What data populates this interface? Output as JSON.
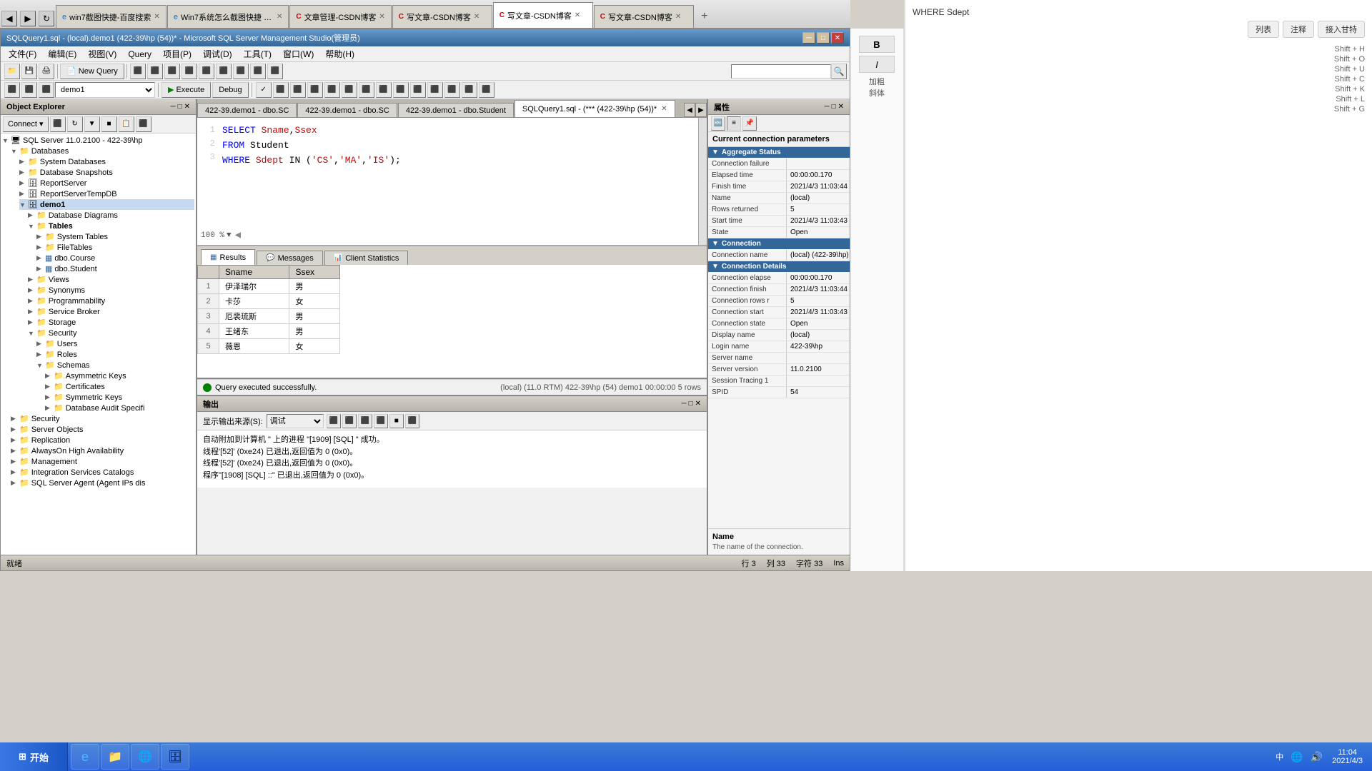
{
  "window": {
    "title": "SQLQuery1.sql - (local).demo1 (422-39\\hp (54))* - Microsoft SQL Server Management Studio(管理员)",
    "tabs": [
      {
        "label": "win7截图快捷-百度搜索",
        "active": false,
        "icon": "ie"
      },
      {
        "label": "Win7系统怎么截图快捷 5种:...",
        "active": false,
        "icon": "ie"
      },
      {
        "label": "文章管理-CSDN博客",
        "active": false,
        "icon": "csdn"
      },
      {
        "label": "写文章-CSDN博客",
        "active": false,
        "icon": "csdn"
      },
      {
        "label": "写文章-CSDN博客",
        "active": true,
        "icon": "csdn"
      },
      {
        "label": "写文章-CSDN博客",
        "active": false,
        "icon": "csdn"
      }
    ]
  },
  "ssms": {
    "title": "SQLQuery1.sql - (local).demo1 (422-39\\hp (54))* - Microsoft SQL Server Management Studio(管理员)",
    "menubar": [
      "文件(F)",
      "编辑(E)",
      "视图(V)",
      "Query",
      "项目(P)",
      "调试(D)",
      "工具(T)",
      "窗口(W)",
      "帮助(H)"
    ],
    "toolbar": {
      "db_selector": "demo1",
      "execute_btn": "Execute",
      "debug_btn": "Debug"
    },
    "doc_tabs": [
      {
        "label": "422-39.demo1 - dbo.SC",
        "active": false
      },
      {
        "label": "422-39.demo1 - dbo.SC",
        "active": false
      },
      {
        "label": "422-39.demo1 - dbo.Student",
        "active": false
      },
      {
        "label": "SQLQuery1.sql - (*** (422-39\\hp (54))*",
        "active": true
      }
    ],
    "sql_code": [
      "SELECT Sname,Ssex",
      "FROM Student",
      "WHERE Sdept IN ('CS','MA','IS');"
    ],
    "zoom": "100 %",
    "result_tabs": [
      {
        "label": "Results",
        "active": true,
        "icon": "grid"
      },
      {
        "label": "Messages",
        "active": false,
        "icon": "msg"
      },
      {
        "label": "Client Statistics",
        "active": false,
        "icon": "chart"
      }
    ],
    "result_columns": [
      "Sname",
      "Ssex"
    ],
    "result_rows": [
      {
        "num": "1",
        "sname": "伊泽瑞尔",
        "ssex": "男"
      },
      {
        "num": "2",
        "sname": "卡莎",
        "ssex": "女"
      },
      {
        "num": "3",
        "sname": "厄裴琉斯",
        "ssex": "男"
      },
      {
        "num": "4",
        "sname": "王绪东",
        "ssex": "男"
      },
      {
        "num": "5",
        "sname": "薇恩",
        "ssex": "女"
      }
    ],
    "status_success": "Query executed successfully.",
    "status_conn": "(local) (11.0 RTM)  422-39\\hp (54)  demo1  00:00:00  5 rows",
    "statusbar": {
      "row": "行 3",
      "col": "列 33",
      "char": "字符 33",
      "ins": "Ins"
    }
  },
  "object_explorer": {
    "header": "Object Explorer",
    "connection": "SQL Server 11.0.2100 - 422-39\\hp",
    "tree": [
      {
        "label": "SQL Server 11.0.2100 - 422-39\\hp",
        "expanded": true,
        "level": 0,
        "icon": "server"
      },
      {
        "label": "Databases",
        "expanded": true,
        "level": 1,
        "icon": "folder"
      },
      {
        "label": "System Databases",
        "expanded": false,
        "level": 2,
        "icon": "folder"
      },
      {
        "label": "Database Snapshots",
        "expanded": false,
        "level": 2,
        "icon": "folder"
      },
      {
        "label": "ReportServer",
        "expanded": false,
        "level": 2,
        "icon": "db"
      },
      {
        "label": "ReportServerTempDB",
        "expanded": false,
        "level": 2,
        "icon": "db"
      },
      {
        "label": "demo1",
        "expanded": true,
        "level": 2,
        "icon": "db"
      },
      {
        "label": "Database Diagrams",
        "expanded": false,
        "level": 3,
        "icon": "folder"
      },
      {
        "label": "Tables",
        "expanded": true,
        "level": 3,
        "icon": "folder",
        "bold": true
      },
      {
        "label": "System Tables",
        "expanded": false,
        "level": 4,
        "icon": "folder"
      },
      {
        "label": "FileTables",
        "expanded": false,
        "level": 4,
        "icon": "folder"
      },
      {
        "label": "dbo.Course",
        "expanded": false,
        "level": 4,
        "icon": "table"
      },
      {
        "label": "dbo.Student",
        "expanded": false,
        "level": 4,
        "icon": "table"
      },
      {
        "label": "Views",
        "expanded": false,
        "level": 3,
        "icon": "folder"
      },
      {
        "label": "Synonyms",
        "expanded": false,
        "level": 3,
        "icon": "folder"
      },
      {
        "label": "Programmability",
        "expanded": false,
        "level": 3,
        "icon": "folder"
      },
      {
        "label": "Service Broker",
        "expanded": false,
        "level": 3,
        "icon": "folder"
      },
      {
        "label": "Storage",
        "expanded": false,
        "level": 3,
        "icon": "folder"
      },
      {
        "label": "Security",
        "expanded": true,
        "level": 3,
        "icon": "folder"
      },
      {
        "label": "Users",
        "expanded": false,
        "level": 4,
        "icon": "folder"
      },
      {
        "label": "Roles",
        "expanded": false,
        "level": 4,
        "icon": "folder"
      },
      {
        "label": "Schemas",
        "expanded": true,
        "level": 4,
        "icon": "folder"
      },
      {
        "label": "Asymmetric Keys",
        "expanded": false,
        "level": 5,
        "icon": "folder"
      },
      {
        "label": "Certificates",
        "expanded": false,
        "level": 5,
        "icon": "folder"
      },
      {
        "label": "Symmetric Keys",
        "expanded": false,
        "level": 5,
        "icon": "folder"
      },
      {
        "label": "Database Audit Specifi",
        "expanded": false,
        "level": 5,
        "icon": "folder"
      },
      {
        "label": "Security",
        "expanded": false,
        "level": 1,
        "icon": "folder"
      },
      {
        "label": "Server Objects",
        "expanded": false,
        "level": 1,
        "icon": "folder"
      },
      {
        "label": "Replication",
        "expanded": false,
        "level": 1,
        "icon": "folder"
      },
      {
        "label": "AlwaysOn High Availability",
        "expanded": false,
        "level": 1,
        "icon": "folder"
      },
      {
        "label": "Management",
        "expanded": false,
        "level": 1,
        "icon": "folder"
      },
      {
        "label": "Integration Services Catalogs",
        "expanded": false,
        "level": 1,
        "icon": "folder"
      },
      {
        "label": "SQL Server Agent (Agent IPs dis",
        "expanded": false,
        "level": 1,
        "icon": "folder"
      }
    ]
  },
  "properties": {
    "header": "属性",
    "title": "Current connection parameters",
    "sections": {
      "aggregate_status": {
        "label": "Aggregate Status",
        "rows": [
          {
            "name": "Connection failure",
            "value": ""
          },
          {
            "name": "Elapsed time",
            "value": "00:00:00.170"
          },
          {
            "name": "Finish time",
            "value": "2021/4/3 11:03:44"
          },
          {
            "name": "Name",
            "value": "(local)"
          },
          {
            "name": "Rows returned",
            "value": "5"
          },
          {
            "name": "Start time",
            "value": "2021/4/3 11:03:43"
          },
          {
            "name": "State",
            "value": "Open"
          }
        ]
      },
      "connection": {
        "label": "Connection",
        "rows": [
          {
            "name": "Connection name",
            "value": "(local) (422-39\\hp)"
          }
        ]
      },
      "connection_details": {
        "label": "Connection Details",
        "rows": [
          {
            "name": "Connection elapse",
            "value": "00:00:00.170"
          },
          {
            "name": "Connection finish",
            "value": "2021/4/3 11:03:44"
          },
          {
            "name": "Connection rows r",
            "value": "5"
          },
          {
            "name": "Connection start",
            "value": "2021/4/3 11:03:43"
          },
          {
            "name": "Connection state",
            "value": "Open"
          },
          {
            "name": "Display name",
            "value": "(local)"
          },
          {
            "name": "Login name",
            "value": "422-39\\hp"
          },
          {
            "name": "Server name",
            "value": ""
          },
          {
            "name": "Server version",
            "value": "11.0.2100"
          },
          {
            "name": "Session Tracing 1",
            "value": ""
          },
          {
            "name": "SPID",
            "value": "54"
          }
        ]
      }
    },
    "footer": {
      "title": "Name",
      "desc": "The name of the connection."
    }
  },
  "output": {
    "header": "输出",
    "source_label": "显示输出来源(S):",
    "source_value": "调试",
    "lines": [
      "自动附加到计算机 \" 上的进程 \"[1909] [SQL] \" 成功。",
      "线程'[52]' (0xe24) 已退出,返回值为 0 (0x0)。",
      "线程'[52]' (0xe24) 已退出,返回值为 0 (0x0)。",
      "程序\"[1908] [SQL] ::\" 已退出,返回值为 0 (0x0)。"
    ]
  },
  "bottom_status": {
    "label": "就绪"
  },
  "win_taskbar": {
    "start_label": "开始",
    "time": "11:04",
    "date": "2021/4/3",
    "apps": [
      "ie",
      "explorer",
      "chrome",
      "ssms"
    ],
    "tray_items": [
      "network",
      "volume",
      "ime",
      "clock"
    ]
  },
  "blog_left": {
    "buttons": [
      {
        "label": "B",
        "name": "bold-btn"
      },
      {
        "label": "I",
        "name": "italic-btn"
      },
      {
        "label": "加粗",
        "name": "bold-label"
      },
      {
        "label": "斜体",
        "name": "italic-label"
      }
    ]
  },
  "blog_right": {
    "buttons": [
      {
        "label": "列表",
        "name": "list-btn"
      },
      {
        "label": "注释",
        "name": "comment-btn"
      },
      {
        "label": "接入甘特",
        "name": "gantt-btn"
      }
    ],
    "shortcuts": [
      {
        "key": "Shift + H",
        "label": ""
      },
      {
        "key": "Shift + O",
        "label": ""
      },
      {
        "key": "Shift + U",
        "label": ""
      },
      {
        "key": "Shift + C",
        "label": ""
      },
      {
        "key": "Shift + K",
        "label": ""
      },
      {
        "key": "Shift + L",
        "label": ""
      },
      {
        "key": "Shift + G",
        "label": ""
      }
    ]
  }
}
